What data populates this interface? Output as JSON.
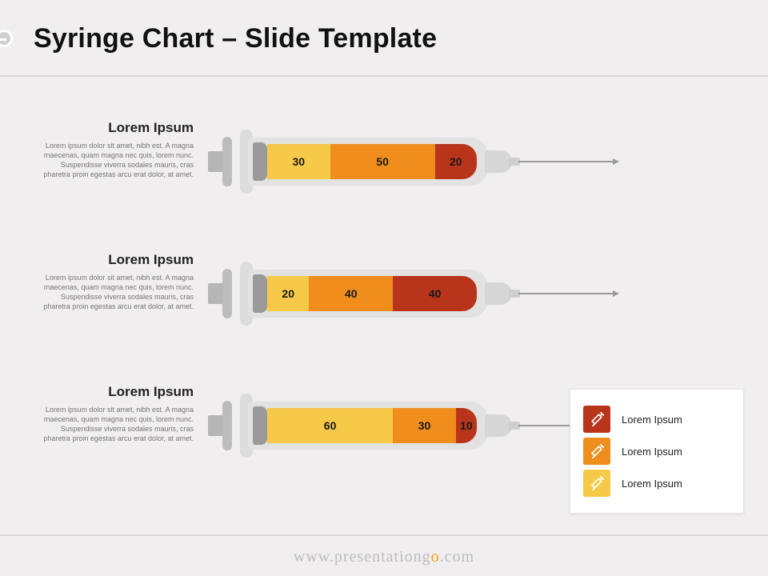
{
  "title": "Syringe Chart – Slide Template",
  "footer_a": "www.presentationg",
  "footer_o": "o",
  "footer_b": ".com",
  "colors": {
    "c1": "#f7c948",
    "c2": "#ef8e1c",
    "c3": "#b8341a"
  },
  "rows": [
    {
      "heading": "Lorem Ipsum",
      "body": "Lorem ipsum dolor sit amet, nibh est. A magna maecenas, quam magna nec quis, lorem nunc. Suspendisse viverra sodales mauris, cras pharetra proin egestas arcu erat dolor, at amet."
    },
    {
      "heading": "Lorem Ipsum",
      "body": "Lorem ipsum dolor sit amet, nibh est. A magna maecenas, quam magna nec quis, lorem nunc. Suspendisse viverra sodales mauris, cras pharetra proin egestas arcu erat dolor, at amet."
    },
    {
      "heading": "Lorem Ipsum",
      "body": "Lorem ipsum dolor sit amet, nibh est. A magna maecenas, quam magna nec quis, lorem nunc. Suspendisse viverra sodales mauris, cras pharetra proin egestas arcu erat dolor, at amet."
    }
  ],
  "legend": [
    {
      "label": "Lorem Ipsum",
      "color": "#b8341a"
    },
    {
      "label": "Lorem Ipsum",
      "color": "#ef8e1c"
    },
    {
      "label": "Lorem Ipsum",
      "color": "#f7c948"
    }
  ],
  "chart_data": {
    "type": "bar",
    "stacked": true,
    "orientation": "horizontal",
    "title": "Syringe Chart – Slide Template",
    "categories": [
      "Lorem Ipsum",
      "Lorem Ipsum",
      "Lorem Ipsum"
    ],
    "series": [
      {
        "name": "Lorem Ipsum",
        "color": "#f7c948",
        "values": [
          30,
          20,
          60
        ]
      },
      {
        "name": "Lorem Ipsum",
        "color": "#ef8e1c",
        "values": [
          50,
          40,
          30
        ]
      },
      {
        "name": "Lorem Ipsum",
        "color": "#b8341a",
        "values": [
          20,
          40,
          10
        ]
      }
    ],
    "xlim": [
      0,
      100
    ]
  }
}
